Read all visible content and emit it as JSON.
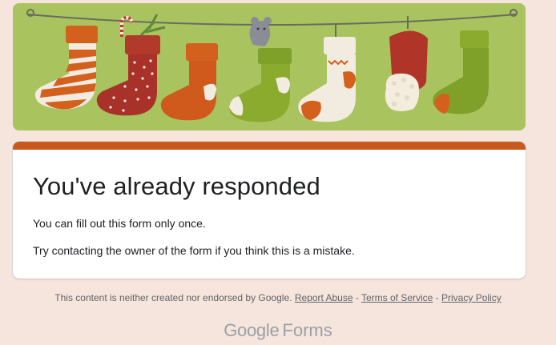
{
  "card": {
    "title": "You've already responded",
    "line1": "You can fill out this form only once.",
    "line2": "Try contacting the owner of the form if you think this is a mistake."
  },
  "footer": {
    "disclaimer": "This content is neither created nor endorsed by Google.",
    "report_abuse": "Report Abuse",
    "sep1": " - ",
    "terms": "Terms of Service",
    "sep2": " - ",
    "privacy": "Privacy Policy"
  },
  "brand": {
    "google": "Google",
    "forms": "Forms"
  },
  "colors": {
    "background": "#f6e5dd",
    "accent": "#c8581c",
    "banner_bg": "#a9c35f"
  }
}
